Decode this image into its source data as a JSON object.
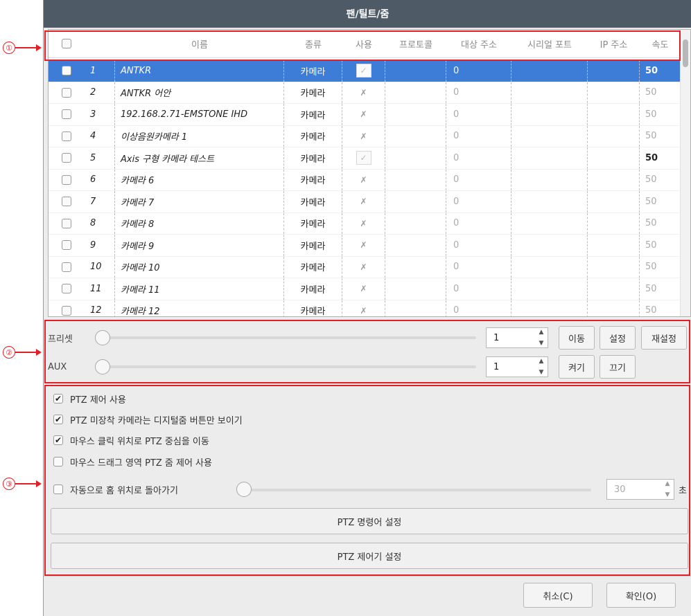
{
  "window": {
    "title": "팬/틸트/줌"
  },
  "table": {
    "headers": [
      "",
      "",
      "이름",
      "종류",
      "사용",
      "프로토콜",
      "대상 주소",
      "시리얼 포트",
      "IP 주소",
      "속도"
    ],
    "rows": [
      {
        "no": "1",
        "name": "ANTKR",
        "type": "카메라",
        "use": "check",
        "protocol": "",
        "address": "0",
        "serial": "",
        "ip": "",
        "speed": "50",
        "selected": true
      },
      {
        "no": "2",
        "name": "ANTKR 어안",
        "type": "카메라",
        "use": "x",
        "protocol": "",
        "address": "0",
        "serial": "",
        "ip": "",
        "speed": "50"
      },
      {
        "no": "3",
        "name": "192.168.2.71-EMSTONE IHD",
        "type": "카메라",
        "use": "x",
        "protocol": "",
        "address": "0",
        "serial": "",
        "ip": "",
        "speed": "50"
      },
      {
        "no": "4",
        "name": "이상음원카메라 1",
        "type": "카메라",
        "use": "x",
        "protocol": "",
        "address": "0",
        "serial": "",
        "ip": "",
        "speed": "50"
      },
      {
        "no": "5",
        "name": "Axis 구형 카메라 테스트",
        "type": "카메라",
        "use": "check",
        "protocol": "",
        "address": "0",
        "serial": "",
        "ip": "",
        "speed": "50",
        "bold": true
      },
      {
        "no": "6",
        "name": "카메라 6",
        "type": "카메라",
        "use": "x",
        "protocol": "",
        "address": "0",
        "serial": "",
        "ip": "",
        "speed": "50"
      },
      {
        "no": "7",
        "name": "카메라 7",
        "type": "카메라",
        "use": "x",
        "protocol": "",
        "address": "0",
        "serial": "",
        "ip": "",
        "speed": "50"
      },
      {
        "no": "8",
        "name": "카메라 8",
        "type": "카메라",
        "use": "x",
        "protocol": "",
        "address": "0",
        "serial": "",
        "ip": "",
        "speed": "50"
      },
      {
        "no": "9",
        "name": "카메라 9",
        "type": "카메라",
        "use": "x",
        "protocol": "",
        "address": "0",
        "serial": "",
        "ip": "",
        "speed": "50"
      },
      {
        "no": "10",
        "name": "카메라 10",
        "type": "카메라",
        "use": "x",
        "protocol": "",
        "address": "0",
        "serial": "",
        "ip": "",
        "speed": "50"
      },
      {
        "no": "11",
        "name": "카메라 11",
        "type": "카메라",
        "use": "x",
        "protocol": "",
        "address": "0",
        "serial": "",
        "ip": "",
        "speed": "50"
      },
      {
        "no": "12",
        "name": "카메라 12",
        "type": "카메라",
        "use": "x",
        "protocol": "",
        "address": "0",
        "serial": "",
        "ip": "",
        "speed": "50"
      }
    ]
  },
  "preset": {
    "label": "프리셋",
    "value": "1",
    "move": "이동",
    "set": "설정",
    "reset": "재설정"
  },
  "aux": {
    "label": "AUX",
    "value": "1",
    "on": "켜기",
    "off": "끄기"
  },
  "options": {
    "ptz_enable": {
      "label": "PTZ 제어 사용",
      "checked": true
    },
    "digital_zoom_only": {
      "label": "PTZ 미장착 카메라는 디지털줌 버튼만 보이기",
      "checked": true
    },
    "click_center": {
      "label": "마우스 클릭 위치로 PTZ 중심을 이동",
      "checked": true
    },
    "drag_zoom": {
      "label": "마우스 드래그 영역 PTZ 줌 제어 사용",
      "checked": false
    },
    "auto_home": {
      "label": "자동으로 홈 위치로 돌아가기",
      "checked": false,
      "seconds": "30",
      "unit": "초"
    }
  },
  "buttons": {
    "ptz_command": "PTZ 명령어 설정",
    "ptz_controller": "PTZ 제어기 설정",
    "cancel": "취소(C)",
    "ok": "확인(O)"
  },
  "markers": [
    "①",
    "②",
    "③"
  ],
  "colors": {
    "annotation": "#e31e24",
    "selection": "#3d7dd8",
    "titlebar": "#4e5a66"
  }
}
